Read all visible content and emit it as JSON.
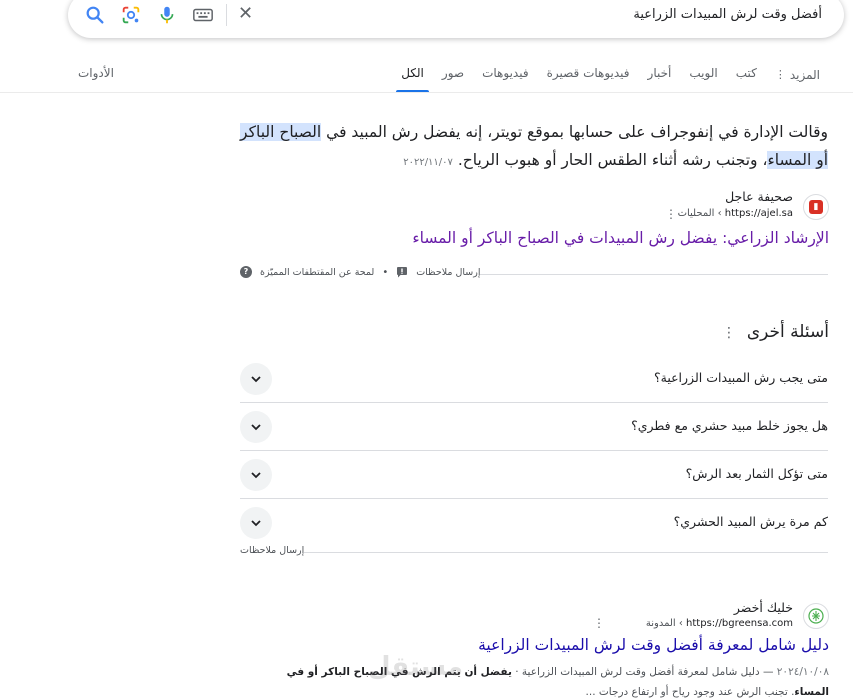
{
  "search": {
    "query": "أفضل وقت لرش المبيدات الزراعية"
  },
  "tabs": [
    {
      "label": "الكل",
      "active": true
    },
    {
      "label": "صور"
    },
    {
      "label": "فيديوهات"
    },
    {
      "label": "فيديوهات قصيرة"
    },
    {
      "label": "أخبار"
    },
    {
      "label": "الويب"
    },
    {
      "label": "كتب"
    },
    {
      "label": "المزيد"
    }
  ],
  "tools_label": "الأدوات",
  "featured": {
    "text_before": "وقالت الإدارة في إنفوجراف على حسابها بموقع تويتر، إنه يفضل رش المبيد في ",
    "highlight": "الصباح الباكر أو المساء",
    "text_after": "، وتجنب رشه أثناء الطقس الحار أو هبوب الرياح.",
    "date": "٢٠٢٢/١١/٠٧",
    "site_name": "صحيفة عاجل",
    "site_url": "https://ajel.sa",
    "site_path": "› المحليات",
    "title": "الإرشاد الزراعي: يفضل رش المبيدات في الصباح الباكر أو المساء",
    "feedback": "إرسال ملاحظات",
    "about": "لمحة عن المقتطفات المميّزة"
  },
  "paa": {
    "title": "أسئلة أخرى",
    "questions": [
      "متى يجب رش المبيدات الزراعية؟",
      "هل يجوز خلط مبيد حشري مع فطري؟",
      "متى تؤكل الثمار بعد الرش؟",
      "كم مرة يرش المبيد الحشري؟"
    ],
    "feedback": "إرسال ملاحظات"
  },
  "result2": {
    "site_name": "خليك أخضر",
    "site_url": "https://bgreensa.com",
    "site_path": "› المدونة",
    "title": "دليل شامل لمعرفة أفضل وقت لرش المبيدات الزراعية",
    "date": "٢٠٢٤/١٠/٠٨",
    "snippet_plain": " — دليل شامل لمعرفة أفضل وقت لرش المبيدات الزراعية · ",
    "snippet_bold": "يفضل أن يتم الرش في الصباح الباكر أو في المساء",
    "snippet_rest": ". تجنب الرش عند وجود رياح أو ارتفاع درجات ..."
  },
  "watermark": "مستقل",
  "colors": {
    "accent": "#1a73e8",
    "visited_link": "#681da8",
    "link": "#1a0dab",
    "highlight": "#d3e3fd"
  }
}
